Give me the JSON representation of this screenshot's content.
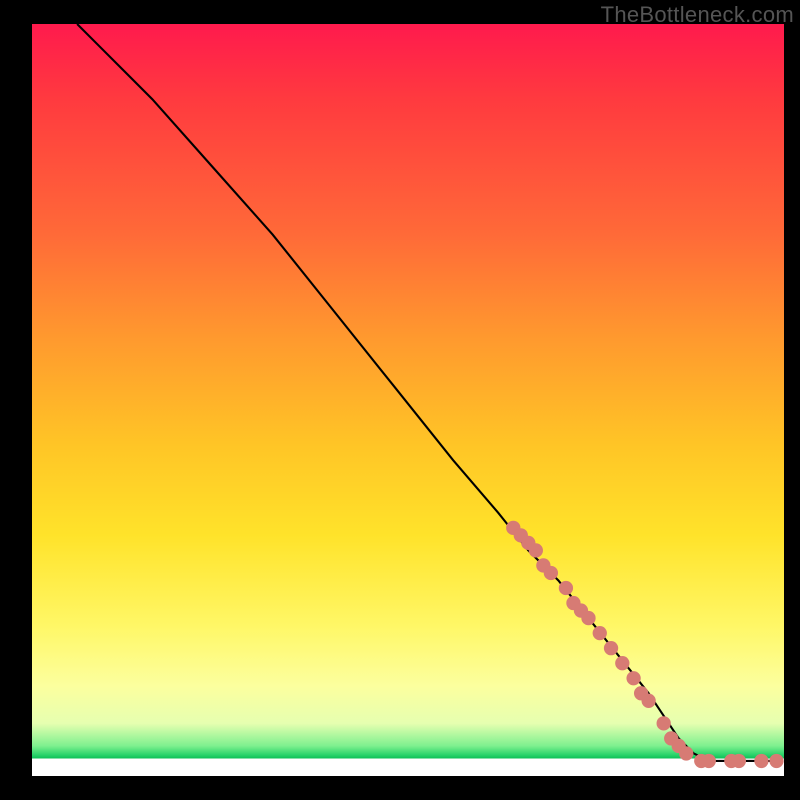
{
  "watermark": "TheBottleneck.com",
  "chart_data": {
    "type": "line",
    "title": "",
    "xlabel": "",
    "ylabel": "",
    "xlim": [
      0,
      100
    ],
    "ylim": [
      0,
      100
    ],
    "note": "Axes unlabeled in source; values are normalized 0–100 from pixel positions. Curve starts top-left, descends roughly linearly to a minimum near x≈86–90, then runs flat along y≈2 to the right edge. Pink dots cluster along the lower-right segment of the curve and along the flat tail.",
    "series": [
      {
        "name": "curve",
        "x": [
          6,
          9,
          12,
          16,
          24,
          32,
          40,
          48,
          56,
          62,
          66,
          70,
          74,
          78,
          82,
          84,
          86,
          88,
          90,
          93,
          96,
          99
        ],
        "y": [
          100,
          97,
          94,
          90,
          81,
          72,
          62,
          52,
          42,
          35,
          30,
          26,
          21,
          16,
          11,
          8,
          5,
          3,
          2,
          2,
          2,
          2
        ]
      }
    ],
    "points": [
      {
        "x": 64,
        "y": 33
      },
      {
        "x": 65,
        "y": 32
      },
      {
        "x": 66,
        "y": 31
      },
      {
        "x": 67,
        "y": 30
      },
      {
        "x": 68,
        "y": 28
      },
      {
        "x": 69,
        "y": 27
      },
      {
        "x": 71,
        "y": 25
      },
      {
        "x": 72,
        "y": 23
      },
      {
        "x": 73,
        "y": 22
      },
      {
        "x": 74,
        "y": 21
      },
      {
        "x": 75.5,
        "y": 19
      },
      {
        "x": 77,
        "y": 17
      },
      {
        "x": 78.5,
        "y": 15
      },
      {
        "x": 80,
        "y": 13
      },
      {
        "x": 81,
        "y": 11
      },
      {
        "x": 82,
        "y": 10
      },
      {
        "x": 84,
        "y": 7
      },
      {
        "x": 85,
        "y": 5
      },
      {
        "x": 86,
        "y": 4
      },
      {
        "x": 87,
        "y": 3
      },
      {
        "x": 89,
        "y": 2
      },
      {
        "x": 90,
        "y": 2
      },
      {
        "x": 93,
        "y": 2
      },
      {
        "x": 94,
        "y": 2
      },
      {
        "x": 97,
        "y": 2
      },
      {
        "x": 99,
        "y": 2
      }
    ]
  }
}
